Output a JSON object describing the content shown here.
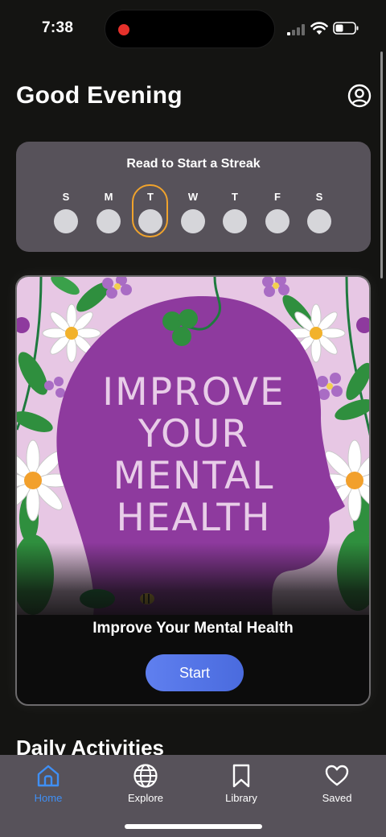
{
  "status_bar": {
    "time": "7:38"
  },
  "header": {
    "greeting": "Good Evening",
    "profile_icon": "person-circle-icon"
  },
  "streak": {
    "title": "Read to Start a Streak",
    "days": [
      {
        "letter": "S",
        "today": false
      },
      {
        "letter": "M",
        "today": false
      },
      {
        "letter": "T",
        "today": true
      },
      {
        "letter": "W",
        "today": false
      },
      {
        "letter": "T",
        "today": false
      },
      {
        "letter": "F",
        "today": false
      },
      {
        "letter": "S",
        "today": false
      }
    ]
  },
  "feature": {
    "art_title_lines": [
      "IMPROVE",
      "YOUR",
      "MENTAL",
      "HEALTH"
    ],
    "title": "Improve Your Mental Health",
    "button_label": "Start"
  },
  "section": {
    "title": "Daily Activities"
  },
  "nav": {
    "items": [
      {
        "label": "Home",
        "icon": "home-icon",
        "active": true
      },
      {
        "label": "Explore",
        "icon": "globe-icon",
        "active": false
      },
      {
        "label": "Library",
        "icon": "bookmark-icon",
        "active": false
      },
      {
        "label": "Saved",
        "icon": "heart-icon",
        "active": false
      }
    ]
  },
  "colors": {
    "accent_blue": "#3f8ff5",
    "today_ring": "#f0a32c",
    "art_purple": "#8e3a9e",
    "art_background": "#e7c7e4"
  }
}
